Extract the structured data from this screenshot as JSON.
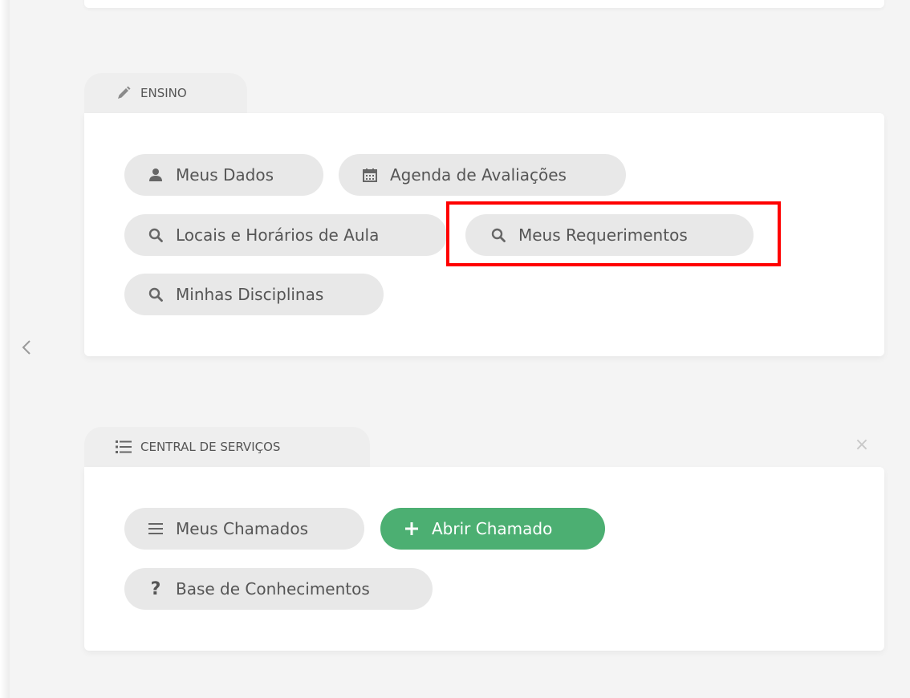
{
  "ensino": {
    "title": "ENSINO",
    "buttons": {
      "meus_dados": "Meus Dados",
      "agenda": "Agenda de Avaliações",
      "locais": "Locais e Horários de Aula",
      "requerimentos": "Meus Requerimentos",
      "disciplinas": "Minhas Disciplinas"
    }
  },
  "central": {
    "title": "CENTRAL DE SERVIÇOS",
    "buttons": {
      "meus_chamados": "Meus Chamados",
      "abrir_chamado": "Abrir Chamado",
      "base": "Base de Conhecimentos"
    },
    "close": "×"
  },
  "colors": {
    "accent_green": "#4caf72",
    "highlight": "#ff0000"
  },
  "icons": {
    "ensino_tab": "pencil-icon",
    "central_tab": "list-icon",
    "meus_dados": "user-icon",
    "agenda": "calendar-icon",
    "search": "search-icon",
    "chamados": "bars-icon",
    "abrir": "plus-icon",
    "base": "question-icon",
    "nav": "chevron-left-icon"
  }
}
